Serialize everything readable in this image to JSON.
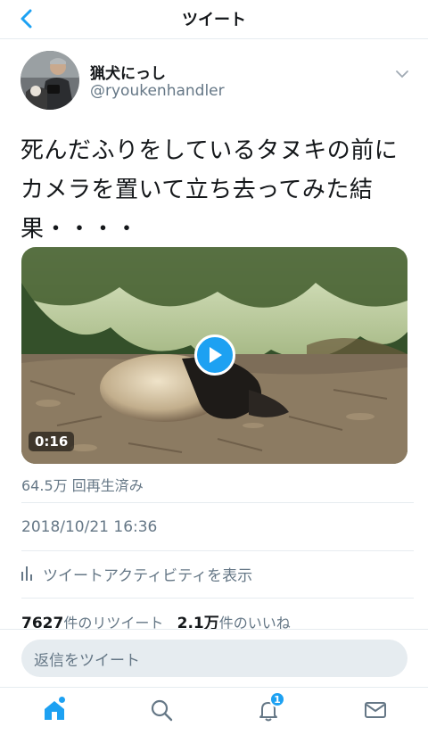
{
  "header": {
    "title": "ツイート"
  },
  "author": {
    "display_name": "猟犬にっし",
    "handle": "@ryoukenhandler"
  },
  "tweet": {
    "text": "死んだふりをしているタヌキの前にカメラを置いて立ち去ってみた結果・・・・",
    "video_duration": "0:16",
    "views": "64.5万 回再生済み",
    "timestamp": "2018/10/21 16:36",
    "activity_label": "ツイートアクティビティを表示"
  },
  "stats": {
    "retweets_count": "7627",
    "retweets_label": "件のリツイート",
    "likes_count": "2.1万",
    "likes_label": "件のいいね"
  },
  "reply": {
    "placeholder": "返信をツイート"
  },
  "tabbar": {
    "notifications_badge": "1"
  },
  "colors": {
    "accent": "#1da1f2",
    "text": "#14171a",
    "secondary": "#657786",
    "border": "#e6ecf0"
  },
  "icons": [
    "back-chevron-icon",
    "chevron-down-icon",
    "play-icon",
    "bar-chart-icon",
    "home-icon",
    "search-icon",
    "bell-icon",
    "mail-icon"
  ]
}
